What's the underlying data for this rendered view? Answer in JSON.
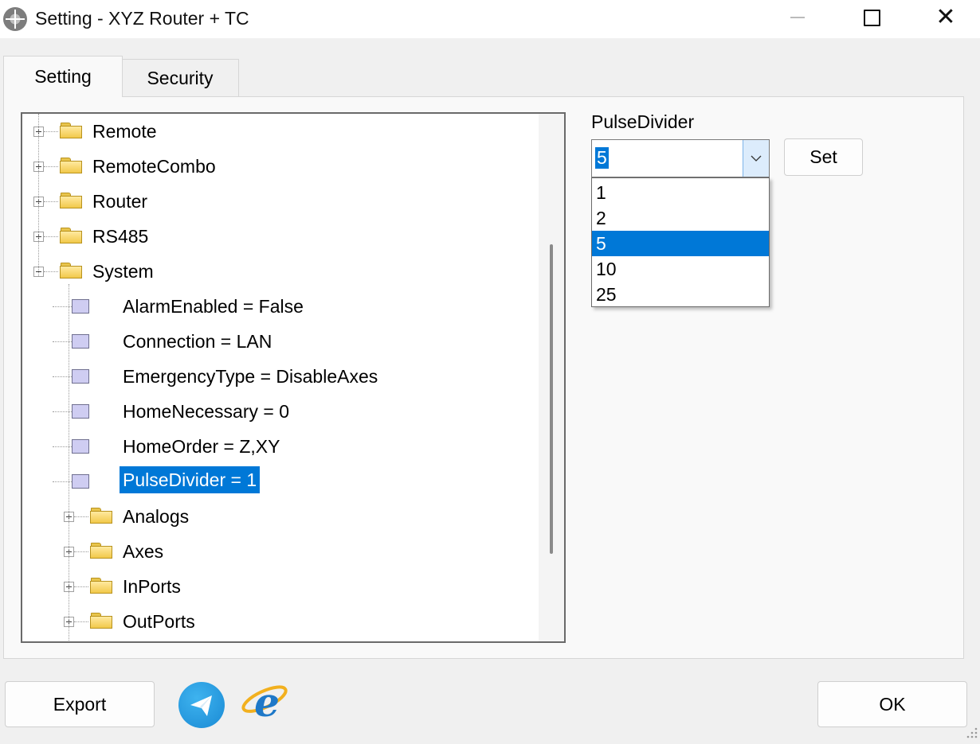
{
  "window": {
    "title": "Setting - XYZ Router + TC",
    "icon": "crosshair-app-icon",
    "close_glyph": "✕"
  },
  "tabs": [
    {
      "label": "Setting",
      "active": true
    },
    {
      "label": "Security",
      "active": false
    }
  ],
  "tree": {
    "nodes": [
      {
        "label": "Remote",
        "type": "folder",
        "expanded": false,
        "level": 0
      },
      {
        "label": "RemoteCombo",
        "type": "folder",
        "expanded": false,
        "level": 0
      },
      {
        "label": "Router",
        "type": "folder",
        "expanded": false,
        "level": 0
      },
      {
        "label": "RS485",
        "type": "folder",
        "expanded": false,
        "level": 0
      },
      {
        "label": "System",
        "type": "folder",
        "expanded": true,
        "level": 0
      },
      {
        "label": "AlarmEnabled = False",
        "type": "leaf",
        "level": 1
      },
      {
        "label": "Connection = LAN",
        "type": "leaf",
        "level": 1
      },
      {
        "label": "EmergencyType = DisableAxes",
        "type": "leaf",
        "level": 1
      },
      {
        "label": "HomeNecessary = 0",
        "type": "leaf",
        "level": 1
      },
      {
        "label": "HomeOrder = Z,XY",
        "type": "leaf",
        "level": 1
      },
      {
        "label": "PulseDivider = 1",
        "type": "leaf",
        "level": 1,
        "selected": true
      },
      {
        "label": "Analogs",
        "type": "folder",
        "expanded": false,
        "level": 1
      },
      {
        "label": "Axes",
        "type": "folder",
        "expanded": false,
        "level": 1
      },
      {
        "label": "InPorts",
        "type": "folder",
        "expanded": false,
        "level": 1
      },
      {
        "label": "OutPorts",
        "type": "folder",
        "expanded": false,
        "level": 1
      }
    ]
  },
  "property": {
    "label": "PulseDivider",
    "value": "5",
    "set_label": "Set",
    "options": [
      "1",
      "2",
      "5",
      "10",
      "25"
    ],
    "selected_option": "5"
  },
  "footer": {
    "export_label": "Export",
    "ok_label": "OK",
    "icons": [
      "telegram-icon",
      "internet-explorer-icon"
    ]
  },
  "colors": {
    "selection": "#0078d7",
    "combo_arrow_bg": "#dcecfc"
  }
}
